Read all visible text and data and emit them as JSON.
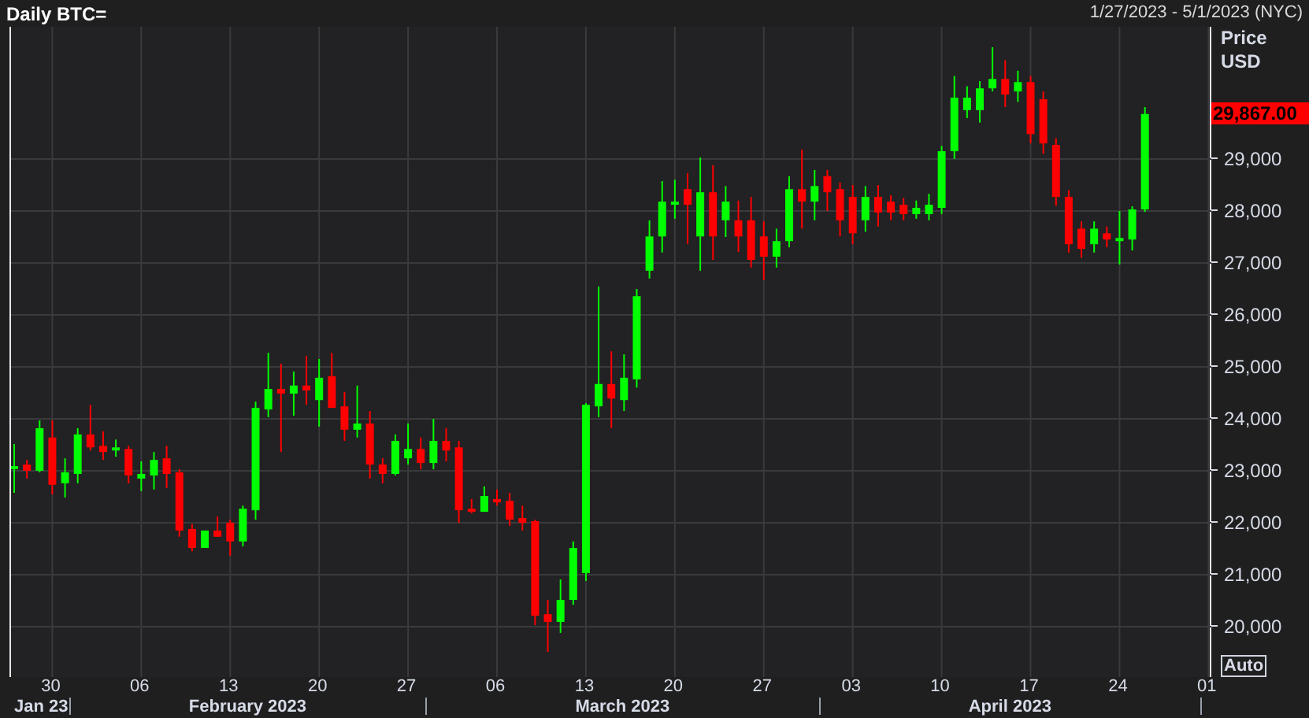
{
  "header": {
    "title": "Daily BTC=",
    "range": "1/27/2023 - 5/1/2023 (NYC)"
  },
  "price_axis": {
    "title": "Price",
    "unit": "USD",
    "last_price": "29,867.00",
    "auto_button": "Auto"
  },
  "x_axis": {
    "months": [
      {
        "label": "Jan 23"
      },
      {
        "label": "February 2023"
      },
      {
        "label": "March 2023"
      },
      {
        "label": "April 2023"
      }
    ]
  },
  "chart": {
    "chart_data": {
      "type": "candlestick",
      "grid": true,
      "xlim": [
        "2023-01-27",
        "2023-05-01"
      ],
      "ylim": [
        19030,
        31545
      ],
      "x": [
        "2023-01-27",
        "2023-01-28",
        "2023-01-29",
        "2023-01-30",
        "2023-01-31",
        "2023-02-01",
        "2023-02-02",
        "2023-02-03",
        "2023-02-04",
        "2023-02-05",
        "2023-02-06",
        "2023-02-07",
        "2023-02-08",
        "2023-02-09",
        "2023-02-10",
        "2023-02-11",
        "2023-02-12",
        "2023-02-13",
        "2023-02-14",
        "2023-02-15",
        "2023-02-16",
        "2023-02-17",
        "2023-02-18",
        "2023-02-19",
        "2023-02-20",
        "2023-02-21",
        "2023-02-22",
        "2023-02-23",
        "2023-02-24",
        "2023-02-25",
        "2023-02-26",
        "2023-02-27",
        "2023-02-28",
        "2023-03-01",
        "2023-03-02",
        "2023-03-03",
        "2023-03-04",
        "2023-03-05",
        "2023-03-06",
        "2023-03-07",
        "2023-03-08",
        "2023-03-09",
        "2023-03-10",
        "2023-03-11",
        "2023-03-12",
        "2023-03-13",
        "2023-03-14",
        "2023-03-15",
        "2023-03-16",
        "2023-03-17",
        "2023-03-18",
        "2023-03-19",
        "2023-03-20",
        "2023-03-21",
        "2023-03-22",
        "2023-03-23",
        "2023-03-24",
        "2023-03-25",
        "2023-03-26",
        "2023-03-27",
        "2023-03-28",
        "2023-03-29",
        "2023-03-30",
        "2023-03-31",
        "2023-04-01",
        "2023-04-02",
        "2023-04-03",
        "2023-04-04",
        "2023-04-05",
        "2023-04-06",
        "2023-04-07",
        "2023-04-08",
        "2023-04-09",
        "2023-04-10",
        "2023-04-11",
        "2023-04-12",
        "2023-04-13",
        "2023-04-14",
        "2023-04-15",
        "2023-04-16",
        "2023-04-17",
        "2023-04-18",
        "2023-04-19",
        "2023-04-20",
        "2023-04-21",
        "2023-04-22",
        "2023-04-23",
        "2023-04-24",
        "2023-04-25",
        "2023-04-26"
      ],
      "ohlc": [
        [
          23030,
          23515,
          22575,
          23090
        ],
        [
          23120,
          23210,
          22850,
          23000
        ],
        [
          23000,
          23970,
          22970,
          23820
        ],
        [
          23640,
          23970,
          22545,
          22730
        ],
        [
          22760,
          23240,
          22485,
          22970
        ],
        [
          22940,
          23820,
          22760,
          23700
        ],
        [
          23700,
          24270,
          23390,
          23450
        ],
        [
          23480,
          23760,
          23210,
          23360
        ],
        [
          23390,
          23600,
          23270,
          23450
        ],
        [
          23420,
          23480,
          22760,
          22910
        ],
        [
          22850,
          23180,
          22610,
          22940
        ],
        [
          22910,
          23360,
          22640,
          23210
        ],
        [
          23240,
          23480,
          22670,
          22940
        ],
        [
          22970,
          23030,
          21730,
          21850
        ],
        [
          21880,
          21970,
          21450,
          21515
        ],
        [
          21515,
          21850,
          21515,
          21850
        ],
        [
          21850,
          22120,
          21730,
          21730
        ],
        [
          22000,
          22060,
          21365,
          21640
        ],
        [
          21640,
          22330,
          21545,
          22270
        ],
        [
          22240,
          24330,
          22060,
          24210
        ],
        [
          24180,
          25270,
          24030,
          24575
        ],
        [
          24575,
          25060,
          23360,
          24485
        ],
        [
          24485,
          24910,
          24060,
          24640
        ],
        [
          24640,
          25210,
          24270,
          24545
        ],
        [
          24360,
          25150,
          23850,
          24790
        ],
        [
          24820,
          25270,
          24210,
          24210
        ],
        [
          24240,
          24515,
          23575,
          23790
        ],
        [
          23790,
          24640,
          23640,
          23910
        ],
        [
          23910,
          24150,
          22850,
          23120
        ],
        [
          23120,
          23240,
          22760,
          22940
        ],
        [
          22940,
          23700,
          22910,
          23575
        ],
        [
          23240,
          23910,
          23120,
          23420
        ],
        [
          23420,
          23640,
          23030,
          23150
        ],
        [
          23150,
          24000,
          23030,
          23575
        ],
        [
          23575,
          23820,
          23180,
          23390
        ],
        [
          23450,
          23575,
          22000,
          22240
        ],
        [
          22270,
          22455,
          22180,
          22210
        ],
        [
          22210,
          22700,
          22210,
          22515
        ],
        [
          22455,
          22640,
          22330,
          22390
        ],
        [
          22420,
          22575,
          21940,
          22060
        ],
        [
          22090,
          22330,
          21850,
          22000
        ],
        [
          22030,
          22060,
          20030,
          20210
        ],
        [
          20240,
          20515,
          19515,
          20090
        ],
        [
          20090,
          20910,
          19880,
          20515
        ],
        [
          20515,
          21640,
          20420,
          21515
        ],
        [
          21030,
          24300,
          20880,
          24270
        ],
        [
          24240,
          26545,
          24030,
          24670
        ],
        [
          24670,
          25300,
          23820,
          24390
        ],
        [
          24360,
          25240,
          24150,
          24790
        ],
        [
          24760,
          26500,
          24600,
          26360
        ],
        [
          26850,
          27820,
          26700,
          27510
        ],
        [
          27510,
          28575,
          27200,
          28180
        ],
        [
          28120,
          28600,
          27850,
          28180
        ],
        [
          28420,
          28730,
          27360,
          28120
        ],
        [
          27510,
          29030,
          26850,
          28360
        ],
        [
          28360,
          28880,
          27060,
          27510
        ],
        [
          27820,
          28480,
          27500,
          28180
        ],
        [
          27820,
          28200,
          27210,
          27510
        ],
        [
          27820,
          28270,
          26910,
          27060
        ],
        [
          27510,
          27800,
          26670,
          27120
        ],
        [
          27120,
          27660,
          26910,
          27420
        ],
        [
          27420,
          28670,
          27300,
          28420
        ],
        [
          28420,
          29180,
          27660,
          28180
        ],
        [
          28180,
          28790,
          27820,
          28480
        ],
        [
          28670,
          28790,
          28000,
          28360
        ],
        [
          28420,
          28550,
          27510,
          27820
        ],
        [
          28270,
          28500,
          27360,
          27570
        ],
        [
          27820,
          28480,
          27600,
          28270
        ],
        [
          28270,
          28500,
          27700,
          27970
        ],
        [
          28180,
          28300,
          27820,
          27970
        ],
        [
          28120,
          28250,
          27820,
          27940
        ],
        [
          27940,
          28200,
          27850,
          28060
        ],
        [
          27940,
          28330,
          27820,
          28120
        ],
        [
          28060,
          29250,
          27940,
          29150
        ],
        [
          29150,
          30600,
          29000,
          30180
        ],
        [
          29940,
          30400,
          29790,
          30180
        ],
        [
          29940,
          30500,
          29700,
          30360
        ],
        [
          30360,
          31150,
          30300,
          30540
        ],
        [
          30540,
          30900,
          30000,
          30240
        ],
        [
          30300,
          30700,
          30100,
          30480
        ],
        [
          30480,
          30600,
          29300,
          29480
        ],
        [
          30150,
          30300,
          29100,
          29300
        ],
        [
          29270,
          29400,
          28100,
          28270
        ],
        [
          28270,
          28400,
          27200,
          27360
        ],
        [
          27660,
          27800,
          27100,
          27270
        ],
        [
          27360,
          27800,
          27200,
          27660
        ],
        [
          27570,
          27700,
          27300,
          27450
        ],
        [
          27420,
          28000,
          26970,
          27480
        ],
        [
          27450,
          28090,
          27240,
          28030
        ],
        [
          28030,
          30000,
          27980,
          29867
        ]
      ],
      "xticks": [
        {
          "value": "2023-01-30",
          "label": "30"
        },
        {
          "value": "2023-02-06",
          "label": "06"
        },
        {
          "value": "2023-02-13",
          "label": "13"
        },
        {
          "value": "2023-02-20",
          "label": "20"
        },
        {
          "value": "2023-02-27",
          "label": "27"
        },
        {
          "value": "2023-03-06",
          "label": "06"
        },
        {
          "value": "2023-03-13",
          "label": "13"
        },
        {
          "value": "2023-03-20",
          "label": "20"
        },
        {
          "value": "2023-03-27",
          "label": "27"
        },
        {
          "value": "2023-04-03",
          "label": "03"
        },
        {
          "value": "2023-04-10",
          "label": "10"
        },
        {
          "value": "2023-04-17",
          "label": "17"
        },
        {
          "value": "2023-04-24",
          "label": "24"
        },
        {
          "value": "2023-05-01",
          "label": "01"
        }
      ],
      "yticks": [
        {
          "value": 20000,
          "label": "20,000"
        },
        {
          "value": 21000,
          "label": "21,000"
        },
        {
          "value": 22000,
          "label": "22,000"
        },
        {
          "value": 23000,
          "label": "23,000"
        },
        {
          "value": 24000,
          "label": "24,000"
        },
        {
          "value": 25000,
          "label": "25,000"
        },
        {
          "value": 26000,
          "label": "26,000"
        },
        {
          "value": 27000,
          "label": "27,000"
        },
        {
          "value": 28000,
          "label": "28,000"
        },
        {
          "value": 29000,
          "label": "29,000"
        }
      ]
    }
  }
}
